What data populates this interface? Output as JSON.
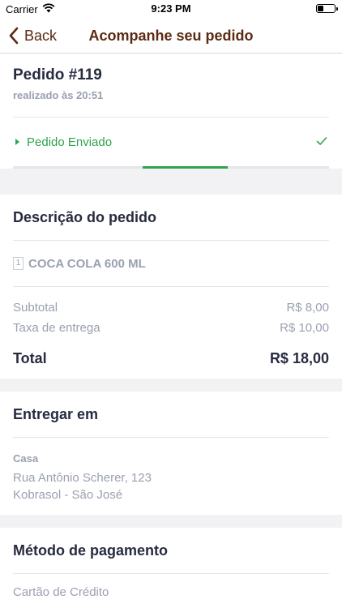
{
  "status_bar": {
    "carrier": "Carrier",
    "time": "9:23 PM"
  },
  "nav": {
    "back_label": "Back",
    "title": "Acompanhe seu pedido"
  },
  "order": {
    "title": "Pedido #119",
    "placed_at": "realizado às 20:51",
    "status": "Pedido Enviado",
    "progress": 0.68
  },
  "description": {
    "title": "Descrição do pedido",
    "items": [
      {
        "qty": "1",
        "name": "COCA COLA 600 ML"
      }
    ],
    "subtotal_label": "Subtotal",
    "subtotal_value": "R$ 8,00",
    "delivery_label": "Taxa de entrega",
    "delivery_value": "R$ 10,00",
    "total_label": "Total",
    "total_value": "R$ 18,00"
  },
  "delivery": {
    "title": "Entregar em",
    "address_name": "Casa",
    "address_line1": "Rua Antônio Scherer, 123",
    "address_line2": "Kobrasol - São José"
  },
  "payment": {
    "title": "Método de pagamento",
    "method": "Cartão de Crédito"
  },
  "colors": {
    "accent": "#5a2a12",
    "success": "#2ea44f",
    "muted": "#9aa0b0",
    "text": "#262b3f"
  }
}
